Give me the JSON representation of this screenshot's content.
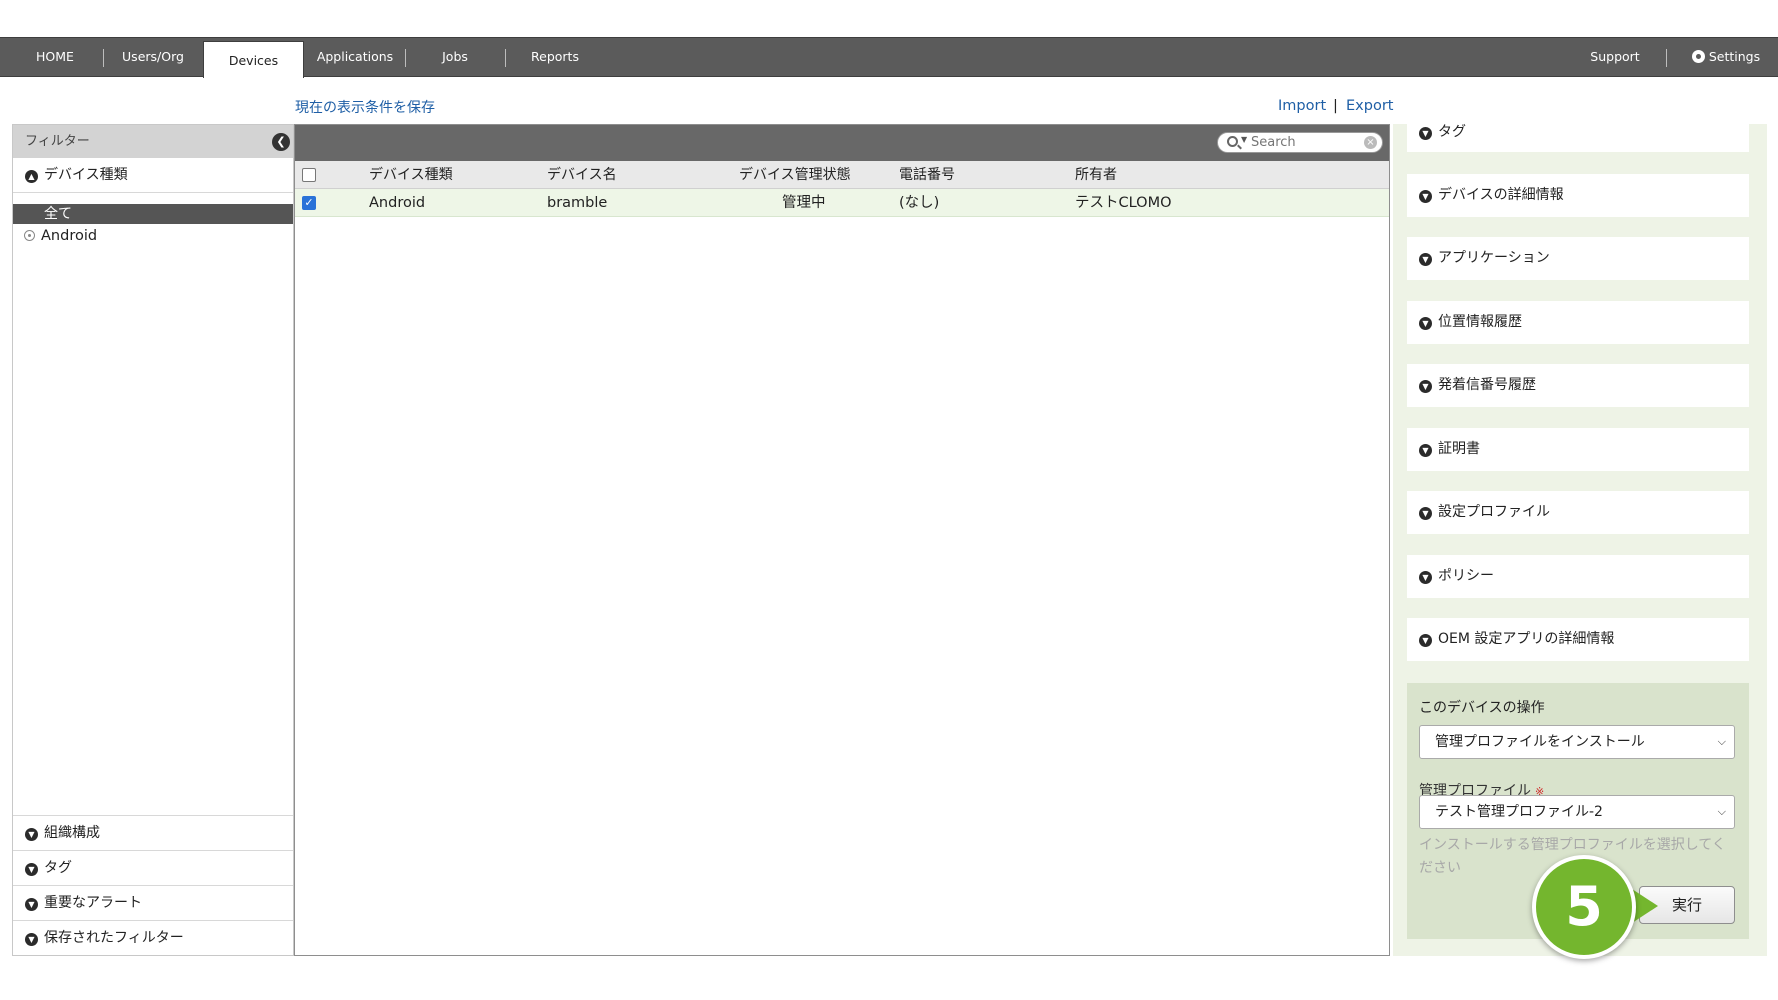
{
  "nav": {
    "left": [
      {
        "label": "HOME"
      },
      {
        "label": "Users/Org"
      },
      {
        "label": "Devices",
        "active": true
      },
      {
        "label": "Applications"
      },
      {
        "label": "Jobs"
      },
      {
        "label": "Reports"
      }
    ],
    "support": "Support",
    "settings": "Settings"
  },
  "save_view": "現在の表示条件を保存",
  "import": "Import",
  "export": "Export",
  "separator": "|",
  "filter": {
    "title": "フィルター",
    "device_type_section": "デバイス種類",
    "device_types": [
      "全て",
      "Android"
    ],
    "bottom_sections": [
      "組織構成",
      "タグ",
      "重要なアラート",
      "保存されたフィルター"
    ]
  },
  "table": {
    "search_placeholder": "Search",
    "columns": [
      "デバイス種類",
      "デバイス名",
      "デバイス管理状態",
      "電話番号",
      "所有者"
    ],
    "rows": [
      {
        "checked": true,
        "type": "Android",
        "name": "bramble",
        "status": "管理中",
        "phone": "(なし)",
        "owner": "テストCLOMO"
      }
    ]
  },
  "right": {
    "items": [
      "タグ",
      "デバイスの詳細情報",
      "アプリケーション",
      "位置情報履歴",
      "発着信番号履歴",
      "証明書",
      "設定プロファイル",
      "ポリシー",
      "OEM 設定アプリの詳細情報"
    ],
    "ops": {
      "title": "このデバイスの操作",
      "action_value": "管理プロファイルをインストール",
      "profile_label": "管理プロファイル",
      "required": "※",
      "profile_value": "テスト管理プロファイル-2",
      "hint": "インストールする管理プロファイルを選択してください",
      "execute": "実行"
    }
  },
  "step_badge": "5",
  "colors": {
    "nav_bg": "#5b5b5b",
    "link": "#1f5fa6",
    "selected_row": "#eef6e7",
    "right_bg": "#eef3e6",
    "badge": "#74b62e"
  },
  "icons": [
    "gear-icon",
    "collapse-left-icon",
    "chevron-down-circle-icon",
    "chevron-up-circle-icon",
    "radio-icon",
    "search-icon",
    "clear-icon"
  ]
}
